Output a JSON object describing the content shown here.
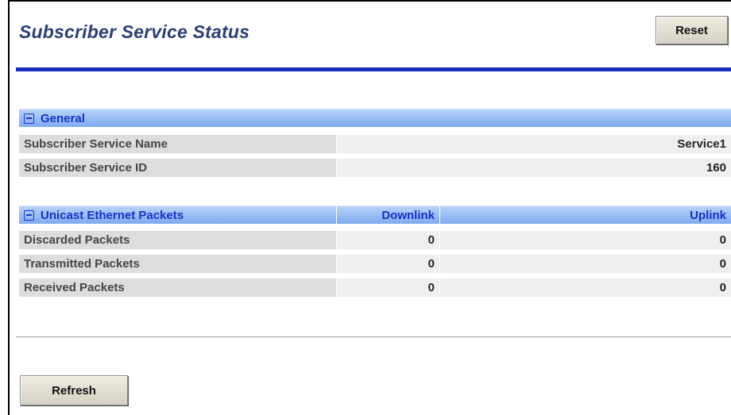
{
  "page": {
    "title": "Subscriber Service Status",
    "reset_label": "Reset",
    "refresh_label": "Refresh"
  },
  "general": {
    "header": "General",
    "rows": [
      {
        "label": "Subscriber Service Name",
        "value": "Service1"
      },
      {
        "label": "Subscriber Service ID",
        "value": "160"
      }
    ]
  },
  "unicast": {
    "header": "Unicast Ethernet Packets",
    "col_downlink": "Downlink",
    "col_uplink": "Uplink",
    "rows": [
      {
        "label": "Discarded Packets",
        "downlink": "0",
        "uplink": "0"
      },
      {
        "label": "Transmitted Packets",
        "downlink": "0",
        "uplink": "0"
      },
      {
        "label": "Received Packets",
        "downlink": "0",
        "uplink": "0"
      }
    ]
  },
  "colors": {
    "title": "#2a3f78",
    "rule": "#1a2bbf",
    "header_text": "#1630c9"
  },
  "icons": [
    "collapse-icon"
  ]
}
